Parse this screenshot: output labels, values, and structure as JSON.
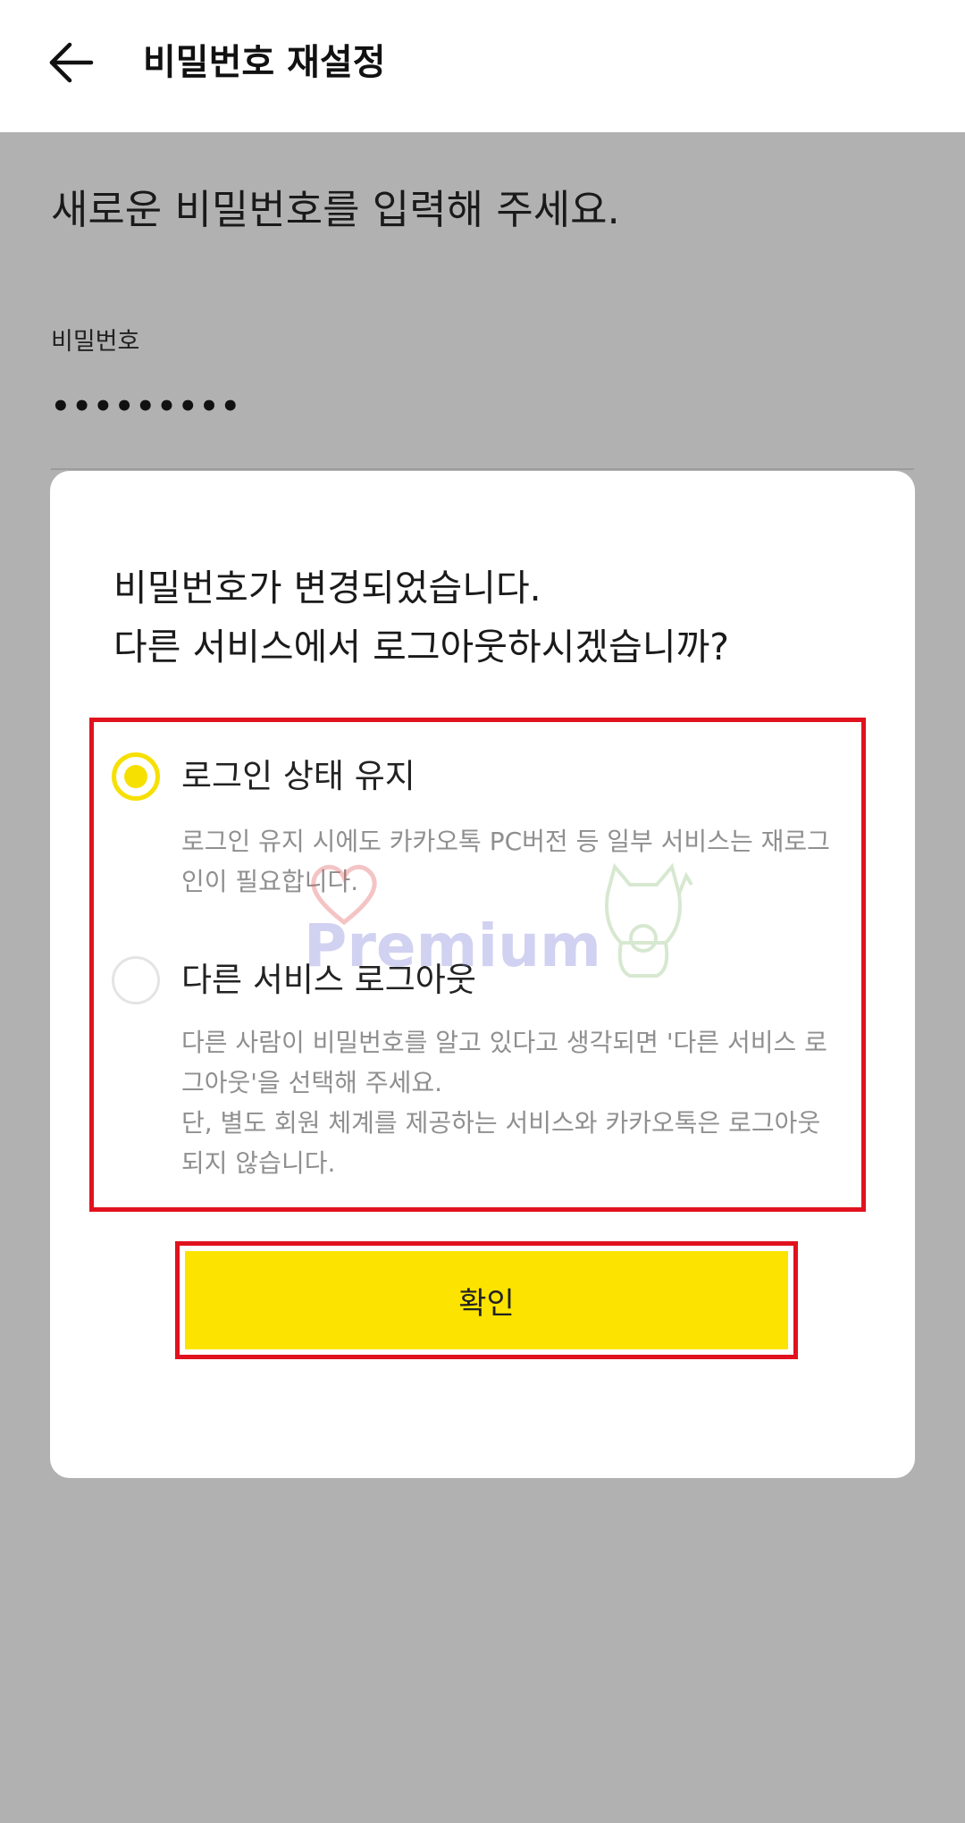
{
  "header": {
    "title": "비밀번호 재설정",
    "back_icon": "arrow-left-icon"
  },
  "background": {
    "heading": "새로운 비밀번호를 입력해 주세요.",
    "password_label": "비밀번호",
    "password_value": "•••••••••"
  },
  "dialog": {
    "title_line1": "비밀번호가 변경되었습니다.",
    "title_line2": "다른 서비스에서 로그아웃하시겠습니까?",
    "options": [
      {
        "label": "로그인 상태 유지",
        "selected": true,
        "desc_line1": "로그인 유지 시에도 카카오톡 PC버전 등 일부 서비스는 재로그",
        "desc_line2": "인이 필요합니다."
      },
      {
        "label": "다른 서비스 로그아웃",
        "selected": false,
        "desc_line1": "다른 사람이 비밀번호를 알고 있다고 생각되면 '다른 서비스 로",
        "desc_line2": "그아웃'을 선택해 주세요.",
        "desc_line3": "단, 별도 회원 체계를 제공하는 서비스와 카카오톡은 로그아웃",
        "desc_line4": "되지 않습니다."
      }
    ],
    "confirm_label": "확인"
  },
  "watermark": {
    "text": "Premium"
  },
  "colors": {
    "accent_yellow": "#fde400",
    "highlight_red": "#e0121e",
    "overlay_gray": "#b1b1b1"
  }
}
